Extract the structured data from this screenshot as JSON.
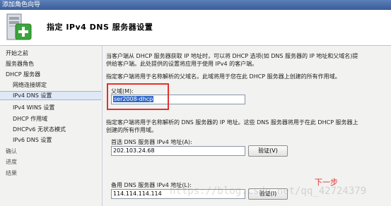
{
  "window": {
    "title": "添加角色向导"
  },
  "header": {
    "title": "指定 IPv4 DNS 服务器设置"
  },
  "sidebar": {
    "items": [
      {
        "label": "开始之前"
      },
      {
        "label": "服务器角色"
      },
      {
        "label": "DHCP 服务器"
      },
      {
        "label": "网络连接绑定"
      },
      {
        "label": "IPv4 DNS 设置"
      },
      {
        "label": "IPv4 WINS 设置"
      },
      {
        "label": "DHCP 作用域"
      },
      {
        "label": "DHCPv6 无状态模式"
      },
      {
        "label": "IPv6 DNS 设置"
      },
      {
        "label": "确认"
      },
      {
        "label": "进度"
      },
      {
        "label": "结果"
      }
    ]
  },
  "main": {
    "intro_line1": "当客户端从 DHCP 服务器获取 IP 地址时，可以将 DHCP 选项(如 DNS 服务器的 IP 地址和父域名)提",
    "intro_line2": "供给客户端。此处提供的设置将应用于使用 IPv4 的客户端。",
    "domain_desc": "指定客户端将用于名称解析的父域名。此域将用于您在此 DHCP 服务器上创建的所有作用域。",
    "parent_domain": {
      "label": "父域(M):",
      "value": "ser2008-dhcp"
    },
    "dns_desc_line1": "指定客户端将用于名称解析的 DNS 服务器的 IP 地址。这些 DNS 服务器将用于在此 DHCP 服务器上",
    "dns_desc_line2": "创建的所有作用域。",
    "preferred_dns": {
      "label": "首选 DNS 服务器 IPv4 地址(A):",
      "value": "202.103.24.68",
      "verify_label": "验证(V)"
    },
    "alternate_dns": {
      "label": "备用 DNS 服务器 IPv4 地址(L):",
      "value": "114.114.114.114",
      "verify_label": "验证(I)"
    }
  },
  "annotation": {
    "next_step": "下一步"
  },
  "watermark": {
    "text": "https://blog.csdn.net/qq_42724379"
  },
  "colors": {
    "highlight_box": "#e0322e",
    "selection": "#3169c6",
    "titlebar": "#3a5d99"
  }
}
